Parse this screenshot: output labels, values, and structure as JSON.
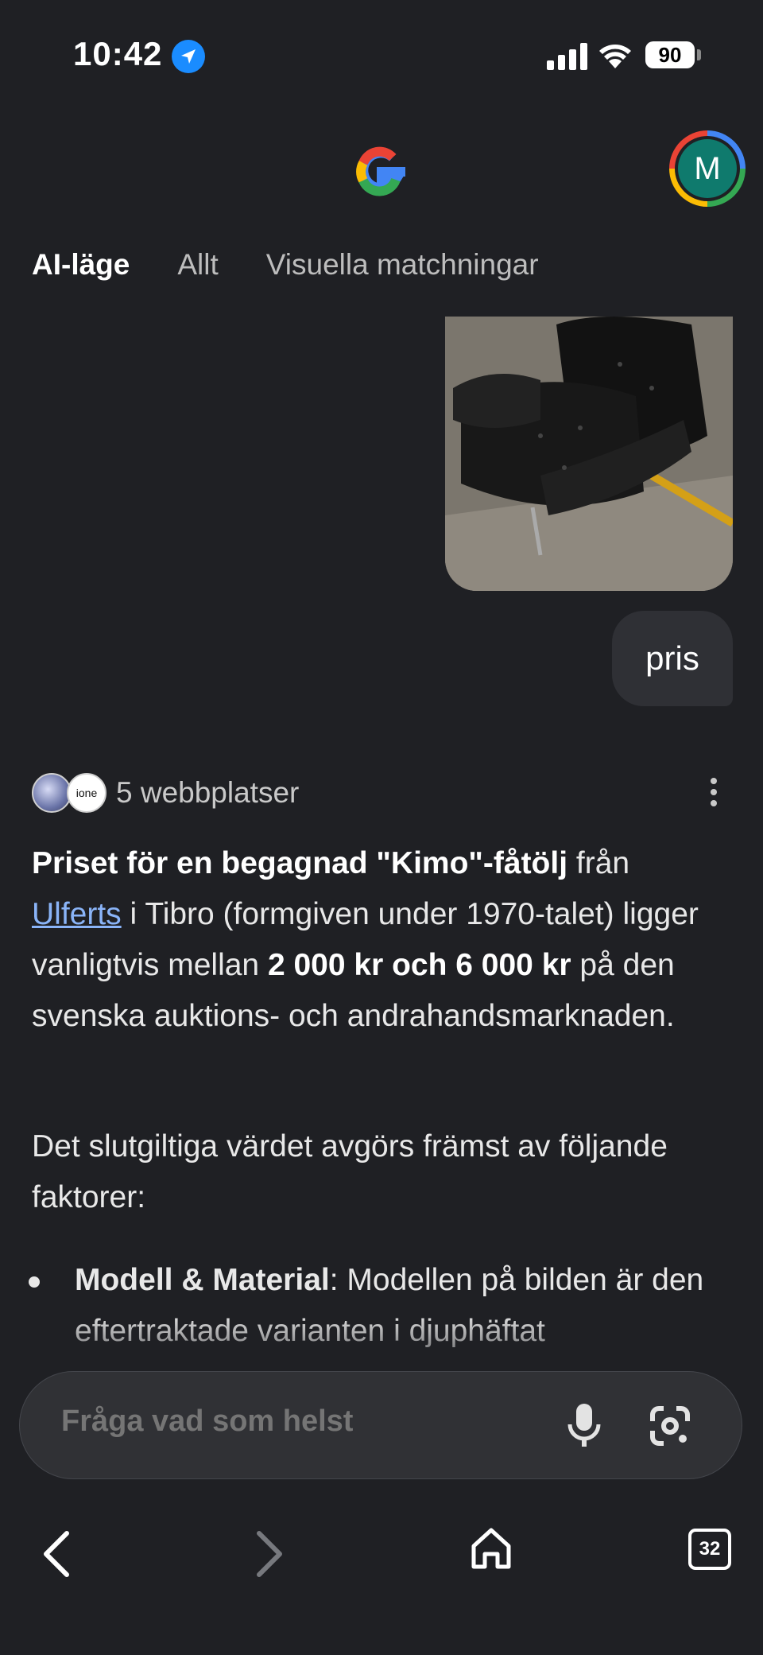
{
  "status": {
    "time": "10:42",
    "battery": "90"
  },
  "header": {
    "avatar_initial": "M"
  },
  "tabs": [
    {
      "label": "AI-läge",
      "active": true
    },
    {
      "label": "Allt",
      "active": false
    },
    {
      "label": "Visuella matchningar",
      "active": false
    }
  ],
  "chat": {
    "user_message": "pris"
  },
  "sources": {
    "label": "5 webbplatser",
    "second_icon_text": "ione"
  },
  "answer": {
    "p1_bold1": "Priset för en begagnad \"Kimo\"-fåtölj",
    "p1_t1": " från ",
    "p1_link": "Ulferts",
    "p1_t2": " i Tibro (formgiven under 1970-talet) ligger vanligtvis mellan ",
    "p1_bold2": "2 000 kr och 6 000 kr",
    "p1_t3": " på den svenska auktions- och andrahandsmarknaden.",
    "p2": "Det slutgiltiga värdet avgörs främst av följande faktorer:",
    "bullet1_bold": "Modell & Material",
    "bullet1_text": ": Modellen på bilden är den eftertraktade varianten i djuphäftat"
  },
  "ask_bar": {
    "placeholder": "Fråga vad som helst"
  },
  "nav": {
    "tab_count": "32"
  }
}
